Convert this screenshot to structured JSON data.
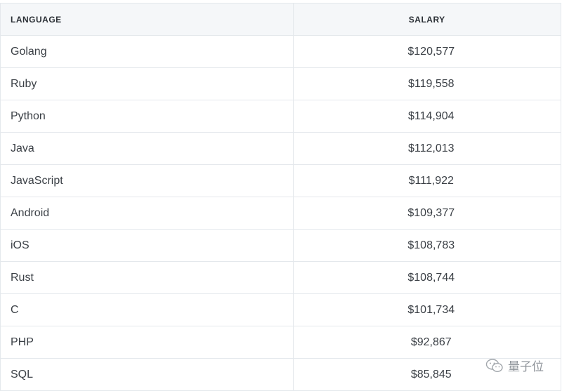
{
  "table": {
    "headers": {
      "language": "LANGUAGE",
      "salary": "SALARY"
    },
    "rows": [
      {
        "language": "Golang",
        "salary": "$120,577"
      },
      {
        "language": "Ruby",
        "salary": "$119,558"
      },
      {
        "language": "Python",
        "salary": "$114,904"
      },
      {
        "language": "Java",
        "salary": "$112,013"
      },
      {
        "language": "JavaScript",
        "salary": "$111,922"
      },
      {
        "language": "Android",
        "salary": "$109,377"
      },
      {
        "language": "iOS",
        "salary": "$108,783"
      },
      {
        "language": "Rust",
        "salary": "$108,744"
      },
      {
        "language": "C",
        "salary": "$101,734"
      },
      {
        "language": "PHP",
        "salary": "$92,867"
      },
      {
        "language": "SQL",
        "salary": "$85,845"
      }
    ]
  },
  "watermark": {
    "text": "量子位",
    "icon": "wechat-icon"
  },
  "colors": {
    "header_bg": "#f5f7f9",
    "border": "#e4e8ec",
    "text": "#3a3f45",
    "watermark": "#8e9399"
  }
}
